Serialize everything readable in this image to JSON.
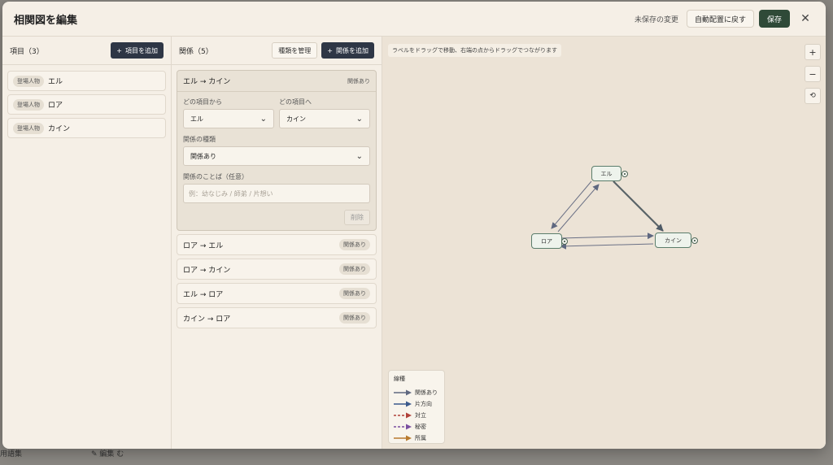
{
  "backdrop": {
    "glossary_label": "用語集",
    "edit_label": "✎ 編集 む"
  },
  "header": {
    "title": "相関図を編集",
    "unsaved": "未保存の変更",
    "auto_layout_label": "自動配置に戻す",
    "save_label": "保存",
    "close_icon": "close-icon"
  },
  "items_panel": {
    "title": "項目（3）",
    "add_label": "項目を追加",
    "items": [
      {
        "tag": "登場人物",
        "name": "エル"
      },
      {
        "tag": "登場人物",
        "name": "ロア"
      },
      {
        "tag": "登場人物",
        "name": "カイン"
      }
    ]
  },
  "relations_panel": {
    "title": "関係（5）",
    "manage_label": "種類を管理",
    "add_label": "関係を追加",
    "expanded": {
      "name": "エル → カイン",
      "badge": "関係あり",
      "from_label": "どの項目から",
      "from_value": "エル",
      "to_label": "どの項目へ",
      "to_value": "カイン",
      "type_label": "関係の種類",
      "type_value": "関係あり",
      "words_label": "関係のことば（任意）",
      "words_placeholder": "例：幼なじみ / 師弟 / 片想い",
      "delete_label": "削除"
    },
    "rows": [
      {
        "name": "ロア → エル",
        "badge": "関係あり"
      },
      {
        "name": "ロア → カイン",
        "badge": "関係あり"
      },
      {
        "name": "エル → ロア",
        "badge": "関係あり"
      },
      {
        "name": "カイン → ロア",
        "badge": "関係あり"
      }
    ]
  },
  "canvas": {
    "hint": "ラベルをドラッグで移動、右端の点からドラッグでつながります",
    "zoom_in": "+",
    "zoom_out": "−",
    "reset": "⟲",
    "nodes": {
      "el": "エル",
      "roa": "ロア",
      "cain": "カイン"
    }
  },
  "legend": {
    "title": "線種",
    "items": [
      {
        "label": "関係あり",
        "color": "#5f6880",
        "dashed": false
      },
      {
        "label": "片方向",
        "color": "#3b5a8c",
        "dashed": false
      },
      {
        "label": "対立",
        "color": "#b0413a",
        "dashed": true
      },
      {
        "label": "秘密",
        "color": "#7a4fa0",
        "dashed": true
      },
      {
        "label": "所属",
        "color": "#b87a2e",
        "dashed": false
      }
    ]
  }
}
